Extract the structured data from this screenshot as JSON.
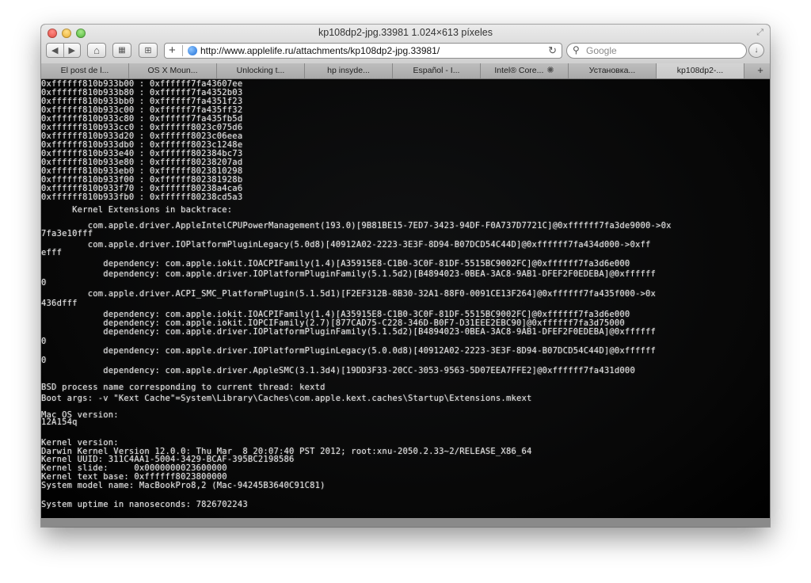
{
  "window": {
    "title": "kp108dp2-jpg.33981 1.024×613 píxeles"
  },
  "toolbar": {
    "back_icon": "back-arrow-icon",
    "forward_icon": "forward-arrow-icon",
    "address_url": "http://www.applelife.ru/attachments/kp108dp2-jpg.33981/",
    "search_placeholder": "Google"
  },
  "tabs": [
    {
      "label": "El post de l..."
    },
    {
      "label": "OS X Moun..."
    },
    {
      "label": "Unlocking t..."
    },
    {
      "label": "hp insyde..."
    },
    {
      "label": "Español - I..."
    },
    {
      "label": "Intel® Core..."
    },
    {
      "label": "Установка..."
    },
    {
      "label": "kp108dp2-..."
    }
  ],
  "terminal_lines": [
    {
      "text": "0xffffff810b933b00 : 0xffffff7fa43607ee"
    },
    {
      "text": "0xffffff810b933b80 : 0xffffff7fa4352b03"
    },
    {
      "text": "0xffffff810b933bb0 : 0xffffff7fa4351f23"
    },
    {
      "text": "0xffffff810b933c00 : 0xffffff7fa435ff32"
    },
    {
      "text": "0xffffff810b933c80 : 0xffffff7fa435fb5d"
    },
    {
      "text": "0xffffff810b933cc0 : 0xffffff8023c075d6"
    },
    {
      "text": "0xffffff810b933d20 : 0xffffff8023c06eea"
    },
    {
      "text": "0xffffff810b933db0 : 0xffffff8023c1248e"
    },
    {
      "text": "0xffffff810b933e40 : 0xffffff802384bc73"
    },
    {
      "text": "0xffffff810b933e80 : 0xffffff80238207ad"
    },
    {
      "text": "0xffffff810b933eb0 : 0xffffff8023810298"
    },
    {
      "text": "0xffffff810b933f00 : 0xffffff802381928b"
    },
    {
      "text": "0xffffff810b933f70 : 0xffffff80238a4ca6"
    },
    {
      "text": "0xffffff810b933fb0 : 0xffffff80238cd5a3"
    },
    {
      "text": "      Kernel Extensions in backtrace:"
    },
    {
      "text": "         com.apple.driver.AppleIntelCPUPowerManagement(193.0)[9B81BE15-7ED7-3423-94DF-F0A737D7721C]@0xffffff7fa3de9000->0x"
    },
    {
      "text": "7fa3e10fff"
    },
    {
      "text": "         com.apple.driver.IOPlatformPluginLegacy(5.0d8)[40912A02-2223-3E3F-8D94-B07DCD54C44D]@0xffffff7fa434d000->0xff"
    },
    {
      "text": "efff"
    },
    {
      "text": "            dependency: com.apple.iokit.IOACPIFamily(1.4)[A35915E8-C1B0-3C0F-81DF-5515BC9002FC]@0xffffff7fa3d6e000"
    },
    {
      "text": "            dependency: com.apple.driver.IOPlatformPluginFamily(5.1.5d2)[B4894023-0BEA-3AC8-9AB1-DFEF2F0EDEBA]@0xffffff"
    },
    {
      "text": "0"
    },
    {
      "text": "         com.apple.driver.ACPI_SMC_PlatformPlugin(5.1.5d1)[F2EF312B-8B30-32A1-88F0-0091CE13F264]@0xffffff7fa435f000->0x"
    },
    {
      "text": "436dfff"
    },
    {
      "text": "            dependency: com.apple.iokit.IOACPIFamily(1.4)[A35915E8-C1B0-3C0F-81DF-5515BC9002FC]@0xffffff7fa3d6e000"
    },
    {
      "text": "            dependency: com.apple.iokit.IOPCIFamily(2.7)[877CAD75-C228-346D-B0F7-D31EEE2EBC90]@0xffffff7fa3d75000"
    },
    {
      "text": "            dependency: com.apple.driver.IOPlatformPluginFamily(5.1.5d2)[B4894023-0BEA-3AC8-9AB1-DFEF2F0EDEBA]@0xffffff"
    },
    {
      "text": "0"
    },
    {
      "text": "            dependency: com.apple.driver.IOPlatformPluginLegacy(5.0.0d8)[40912A02-2223-3E3F-8D94-B07DCD54C44D]@0xffffff"
    },
    {
      "text": "0"
    },
    {
      "text": "            dependency: com.apple.driver.AppleSMC(3.1.3d4)[19DD3F33-20CC-3053-9563-5D07EEA7FFE2]@0xffffff7fa431d000"
    },
    {
      "text": "BSD process name corresponding to current thread: kextd"
    },
    {
      "text": "Boot args: -v \"Kext Cache\"=System\\Library\\Caches\\com.apple.kext.caches\\Startup\\Extensions.mkext"
    },
    {
      "text": ""
    },
    {
      "text": "Mac OS version:"
    },
    {
      "text": "12A154q"
    },
    {
      "text": ""
    },
    {
      "text": "Kernel version:"
    },
    {
      "text": "Darwin Kernel Version 12.0.0: Thu Mar  8 20:07:40 PST 2012; root:xnu-2050.2.33~2/RELEASE_X86_64"
    },
    {
      "text": "Kernel UUID: 311C4AA1-5004-3429-BCAF-395BC2198586"
    },
    {
      "text": "Kernel slide:     0x0000000023600000"
    },
    {
      "text": "Kernel text base: 0xffffff8023800000"
    },
    {
      "text": "System model name: MacBookPro8,2 (Mac-94245B3640C91C81)"
    },
    {
      "text": ""
    },
    {
      "text": "System uptime in nanoseconds: 7826702243"
    }
  ]
}
